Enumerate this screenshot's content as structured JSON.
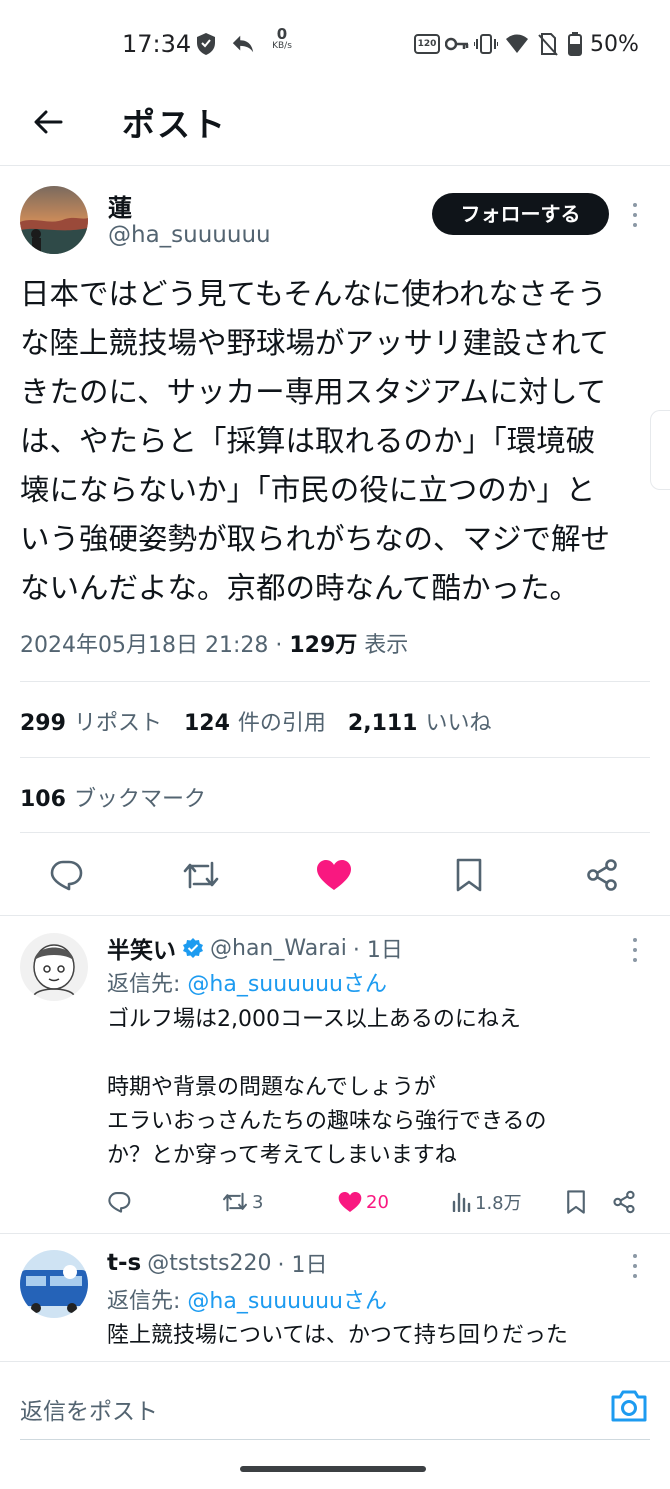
{
  "status_bar": {
    "time": "17:34",
    "net_speed_value": "0",
    "net_speed_unit": "KB/s",
    "hd_label": "120",
    "battery": "50%"
  },
  "header": {
    "title": "ポスト"
  },
  "post": {
    "author_name": "蓮",
    "author_handle": "@ha_suuuuuu",
    "follow_label": "フォローする",
    "text": "日本ではどう見てもそんなに使われなさそう\nな陸上競技場や野球場がアッサリ建設されて\nきたのに、サッカー専用スタジアムに対して\nは、やたらと「採算は取れるのか」「環境破\n壊にならないか」「市民の役に立つのか」と\nいう強硬姿勢が取られがちなの、マジで解せ\nないんだよな。京都の時なんて酷かった。",
    "datetime": "2024年05月18日 21:28",
    "separator": " · ",
    "views_count": "129万",
    "views_label": "表示",
    "reposts_count": "299",
    "reposts_label": "リポスト",
    "quotes_count": "124",
    "quotes_label": "件の引用",
    "likes_count": "2,111",
    "likes_label": "いいね",
    "bookmarks_count": "106",
    "bookmarks_label": "ブックマーク",
    "liked_color": "#f91880"
  },
  "replies": [
    {
      "name": "半笑い",
      "handle": "@han_Warai",
      "time": "· 1日",
      "reply_to_prefix": "返信先: ",
      "reply_to_handle": "@ha_suuuuuuさん",
      "text": "ゴルフ場は2,000コース以上あるのにねえ\n\n時期や背景の問題なんでしょうが\nエラいおっさんたちの趣味なら強行できるの\nか？とか穿って考えてしまいますね",
      "reposts": "3",
      "likes": "20",
      "views": "1.8万"
    },
    {
      "name": "t-s",
      "handle": "@tststs220",
      "time": "· 1日",
      "reply_to_prefix": "返信先: ",
      "reply_to_handle": "@ha_suuuuuuさん",
      "text": "陸上競技場については、かつて持ち回りだった"
    }
  ],
  "composer": {
    "placeholder": "返信をポスト"
  },
  "colors": {
    "accent": "#1d9bf0",
    "like": "#f91880",
    "text": "#0f1419",
    "muted": "#536471"
  }
}
